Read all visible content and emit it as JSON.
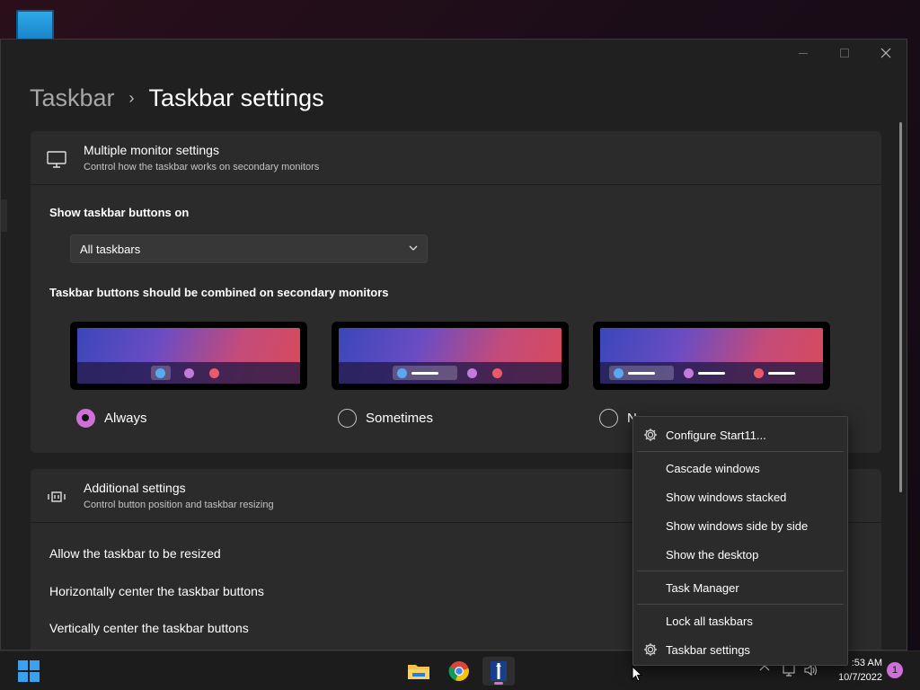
{
  "window": {
    "breadcrumb_parent": "Taskbar",
    "breadcrumb_separator": "›",
    "breadcrumb_current": "Taskbar settings"
  },
  "monitor_card": {
    "title": "Multiple monitor settings",
    "subtitle": "Control how the taskbar works on secondary monitors",
    "show_buttons_label": "Show taskbar buttons on",
    "dropdown_value": "All taskbars",
    "combine_label": "Taskbar buttons should be combined on secondary monitors",
    "options": [
      {
        "label": "Always",
        "selected": true
      },
      {
        "label": "Sometimes",
        "selected": false
      },
      {
        "label": "N",
        "selected": false
      }
    ]
  },
  "additional_card": {
    "title": "Additional settings",
    "subtitle": "Control button position and taskbar resizing",
    "rows": [
      "Allow the taskbar to be resized",
      "Horizontally center the taskbar buttons",
      "Vertically center the taskbar buttons"
    ]
  },
  "context_menu": {
    "items": [
      {
        "label": "Configure Start11...",
        "icon": "gear-icon"
      },
      {
        "label": "Cascade windows"
      },
      {
        "label": "Show windows stacked"
      },
      {
        "label": "Show windows side by side"
      },
      {
        "label": "Show the desktop"
      },
      {
        "label": "Task Manager"
      },
      {
        "label": "Lock all taskbars"
      },
      {
        "label": "Taskbar settings",
        "icon": "gear-icon"
      }
    ]
  },
  "taskbar": {
    "apps": [
      "file-explorer-icon",
      "chrome-icon",
      "start11-icon"
    ],
    "time": ":53 AM",
    "date": "10/7/2022",
    "notification_count": "1"
  },
  "colors": {
    "accent": "#cf6fd8",
    "window_bg": "#202020",
    "card_bg": "#2b2b2b"
  }
}
